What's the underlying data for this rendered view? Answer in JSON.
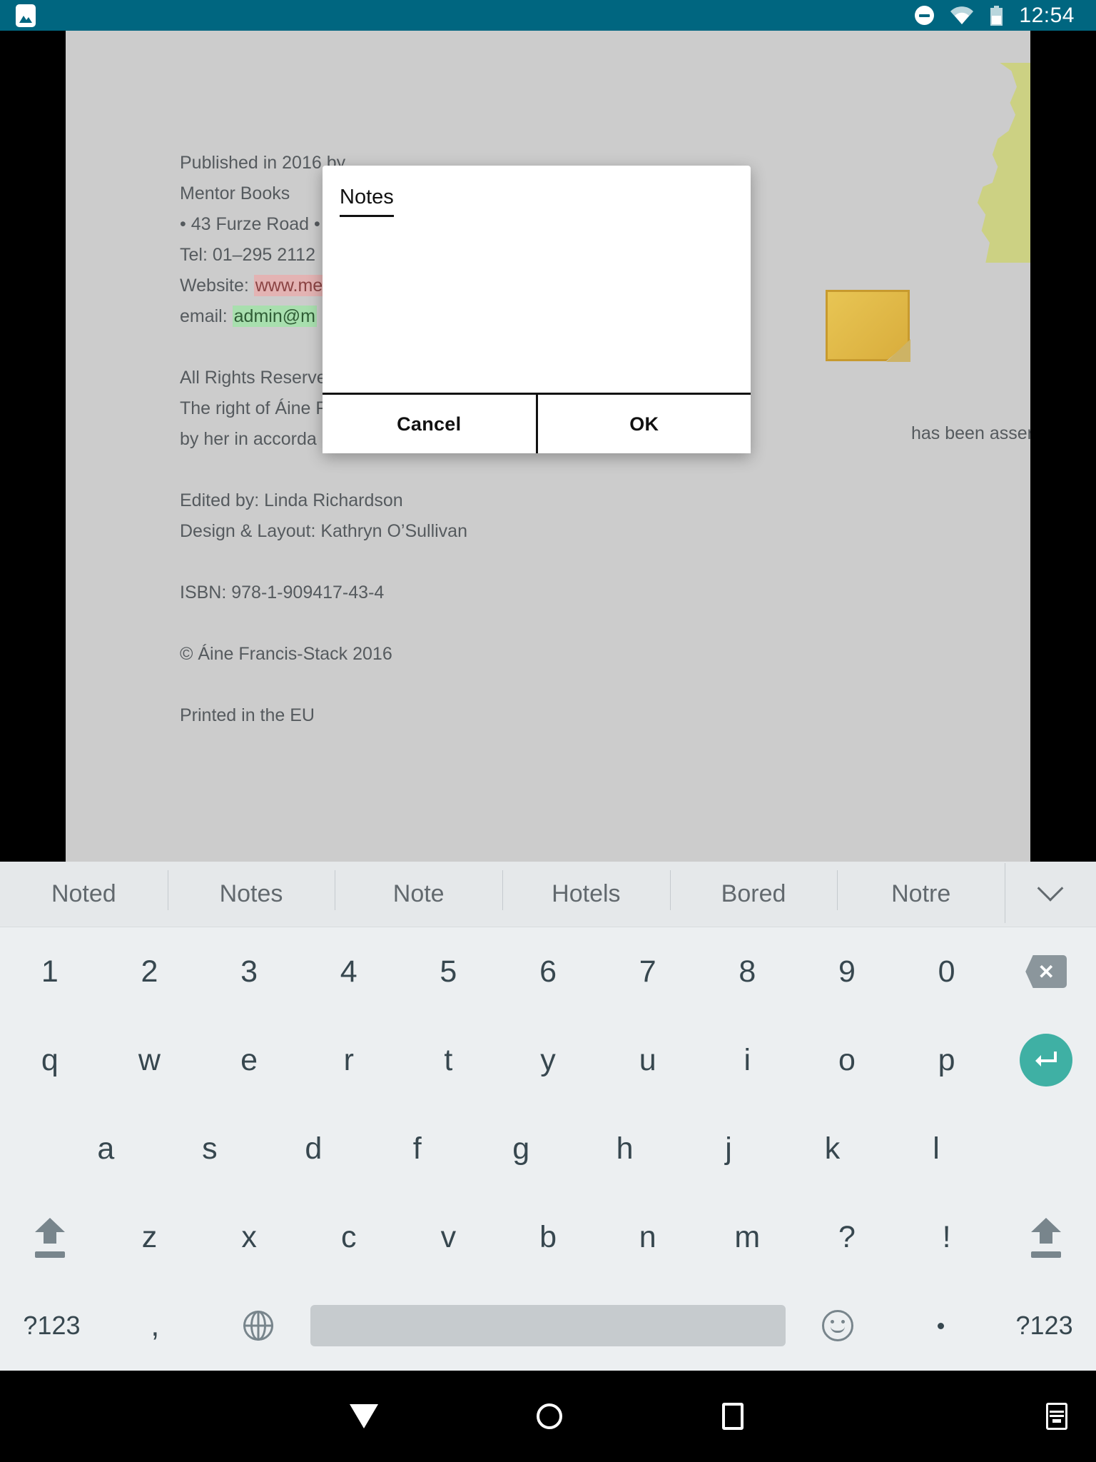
{
  "status_bar": {
    "app_icon": "gallery-image-icon",
    "icons": [
      "do-not-disturb-icon",
      "wifi-icon",
      "battery-icon"
    ],
    "time": "12:54",
    "background_color": "#006680"
  },
  "document": {
    "background_color": "#cccccc",
    "lines": [
      {
        "text": "Published in 2016 by"
      },
      {
        "text": "Mentor Books"
      },
      {
        "text": "• 43 Furze Road •"
      },
      {
        "text": "Tel: 01–295 2112"
      },
      {
        "text": "Website: ",
        "highlight_red": "www.me"
      },
      {
        "text": "email: ",
        "highlight_green": "admin@m"
      },
      {
        "text": ""
      },
      {
        "text": "All Rights Reserve"
      },
      {
        "text": "The right of Áine F",
        "tail": "has been asserted"
      },
      {
        "text": "by her in  accorda"
      },
      {
        "text": ""
      },
      {
        "text": "Edited by: Linda Richardson"
      },
      {
        "text": "Design & Layout: Kathryn O’Sullivan"
      },
      {
        "text": ""
      },
      {
        "text": "ISBN: 978-1-909417-43-4"
      },
      {
        "text": ""
      },
      {
        "text": "© Áine Francis-Stack 2016"
      },
      {
        "text": ""
      },
      {
        "text": "Printed in the EU"
      }
    ],
    "sticky_note": "sticky-note-image",
    "map_shape": "ireland-map-shape",
    "map_color": "#ccd183"
  },
  "dialog": {
    "input_value": "Notes",
    "input_placeholder": "",
    "cancel_label": "Cancel",
    "ok_label": "OK"
  },
  "keyboard": {
    "suggestions": [
      "Noted",
      "Notes",
      "Note",
      "Hotels",
      "Bored",
      "Notre"
    ],
    "more_icon": "chevron-down-icon",
    "row_numbers": [
      "1",
      "2",
      "3",
      "4",
      "5",
      "6",
      "7",
      "8",
      "9",
      "0"
    ],
    "backspace_glyph": "✕",
    "row_top": [
      "q",
      "w",
      "e",
      "r",
      "t",
      "y",
      "u",
      "i",
      "o",
      "p"
    ],
    "enter_glyph": "↵",
    "row_home": [
      "a",
      "s",
      "d",
      "f",
      "g",
      "h",
      "j",
      "k",
      "l"
    ],
    "row_bottom": [
      "z",
      "x",
      "c",
      "v",
      "b",
      "n",
      "m",
      "?",
      "!"
    ],
    "shift_left": "shift-key",
    "shift_right": "shift-key",
    "symbols_left_label": "?123",
    "comma_label": ",",
    "globe_label": "globe-icon",
    "space_label": "",
    "emoji_label": "emoji-icon",
    "period_label": ".",
    "symbols_right_label": "?123",
    "enter_color": "#3fb0a4",
    "background_color": "#eceff1"
  },
  "nav_bar": {
    "back": "back-triangle-icon",
    "home": "home-circle-icon",
    "recents": "recents-square-icon",
    "keyboard": "hide-keyboard-icon"
  }
}
